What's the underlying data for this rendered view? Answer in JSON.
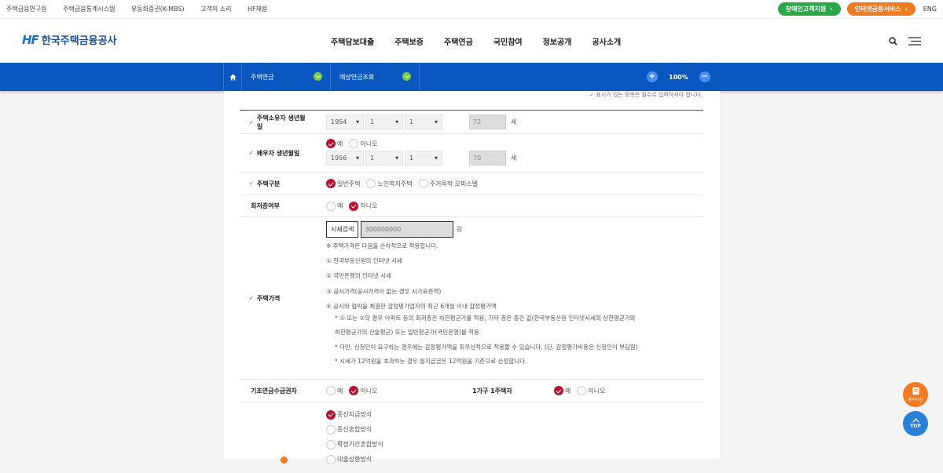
{
  "topbar": {
    "links": [
      "주택금융연구원",
      "주택금융통계시스템",
      "유동화증권(K-MBS)",
      "고객의 소리",
      "HF채용"
    ],
    "green_btn": "장애인고객지원",
    "orange_btn": "인터넷금융서비스",
    "lang": "ENG"
  },
  "header": {
    "logo_mark": "HF",
    "logo_name": "한국주택금융공사",
    "gnb": [
      "주택담보대출",
      "주택보증",
      "주택연금",
      "국민참여",
      "정보공개",
      "공사소개"
    ]
  },
  "subnav": {
    "menu1": "주택연금",
    "menu2": "예상연금조회",
    "zoom": "100%"
  },
  "form": {
    "notice": "표시가 있는 항목은 필수로 입력하셔야 합니다.",
    "owner_birth": {
      "label": "주택소유자 생년월일",
      "year": "1954",
      "month": "1",
      "day": "1",
      "age": "72",
      "unit": "세"
    },
    "spouse_birth": {
      "label": "배우자 생년월일",
      "yes": "예",
      "no": "아니오",
      "year": "1956",
      "month": "1",
      "day": "1",
      "age": "70",
      "unit": "세"
    },
    "house_type": {
      "label": "주택구분",
      "opt1": "일반주택",
      "opt2": "노인복지주택",
      "opt3": "주거목적 오피스텔"
    },
    "lowest_floor": {
      "label": "최저층여부",
      "yes": "예",
      "no": "아니오"
    },
    "price": {
      "label": "주택가격",
      "search_btn": "시세검색",
      "value": "300000000",
      "unit": "원",
      "lines": [
        "※ 주택가격은 다음을 순차적으로 적용합니다.",
        "① 한국부동산원의 인터넷 시세",
        "② 국민은행의 인터넷 시세",
        "③ 공시가격(공시가격이 없는 경우 시가표준액)",
        "④ 공사와 협약을 체결한 감정평가업자의 최근 6개월 이내 감정평가액",
        "* ① 또는 ②의 경우 아파트 등의 최저층은 하한평균가를 적용, 기타 층은 중간 값(한국부동산원 인터넷시세의 상한평균가와",
        "하한평균가의 산술평균) 또는 일반평균가(국민은행)를 적용",
        "* 다만, 신청인이 요구하는 경우에는 감정평가액을 최우선적으로 적용할 수 있습니다. (단, 감정평가비용은 신청인이 부담함)",
        "* 시세가 12억원을 초과하는 경우 월지급금은 12억원을 기준으로 산정합니다."
      ]
    },
    "basic_pension": {
      "label": "기초연금수급권자",
      "yes": "예",
      "no": "아니오"
    },
    "one_house": {
      "label": "1가구 1주택자",
      "yes": "예",
      "no": "아니오"
    },
    "payment": {
      "opts": [
        "종신지급방식",
        "종신혼합방식",
        "확정기간혼합방식",
        "대출상환방식"
      ]
    }
  },
  "float": {
    "btn1": "용어사전",
    "btn2": "TOP"
  },
  "colors": {
    "primary": "#0a57c2",
    "accent_red": "#b8132e",
    "green": "#2aa84a",
    "orange": "#f07b22"
  }
}
